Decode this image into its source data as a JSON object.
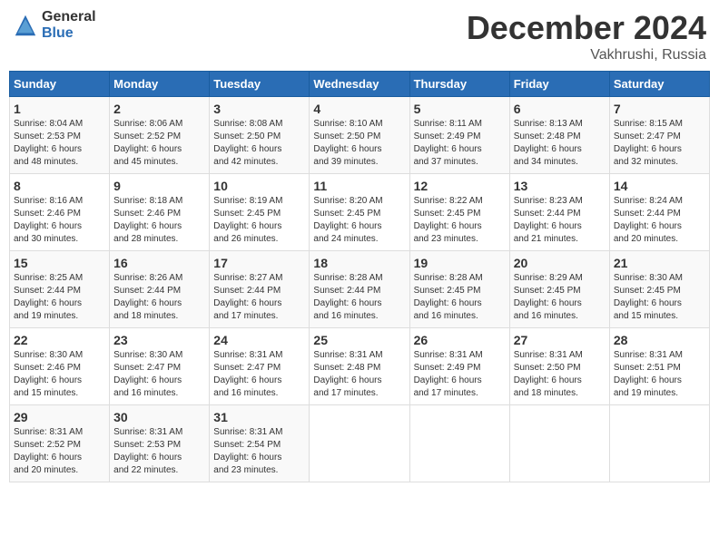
{
  "header": {
    "logo_general": "General",
    "logo_blue": "Blue",
    "title": "December 2024",
    "subtitle": "Vakhrushi, Russia"
  },
  "columns": [
    "Sunday",
    "Monday",
    "Tuesday",
    "Wednesday",
    "Thursday",
    "Friday",
    "Saturday"
  ],
  "weeks": [
    [
      {
        "day": "1",
        "info": "Sunrise: 8:04 AM\nSunset: 2:53 PM\nDaylight: 6 hours\nand 48 minutes."
      },
      {
        "day": "2",
        "info": "Sunrise: 8:06 AM\nSunset: 2:52 PM\nDaylight: 6 hours\nand 45 minutes."
      },
      {
        "day": "3",
        "info": "Sunrise: 8:08 AM\nSunset: 2:50 PM\nDaylight: 6 hours\nand 42 minutes."
      },
      {
        "day": "4",
        "info": "Sunrise: 8:10 AM\nSunset: 2:50 PM\nDaylight: 6 hours\nand 39 minutes."
      },
      {
        "day": "5",
        "info": "Sunrise: 8:11 AM\nSunset: 2:49 PM\nDaylight: 6 hours\nand 37 minutes."
      },
      {
        "day": "6",
        "info": "Sunrise: 8:13 AM\nSunset: 2:48 PM\nDaylight: 6 hours\nand 34 minutes."
      },
      {
        "day": "7",
        "info": "Sunrise: 8:15 AM\nSunset: 2:47 PM\nDaylight: 6 hours\nand 32 minutes."
      }
    ],
    [
      {
        "day": "8",
        "info": "Sunrise: 8:16 AM\nSunset: 2:46 PM\nDaylight: 6 hours\nand 30 minutes."
      },
      {
        "day": "9",
        "info": "Sunrise: 8:18 AM\nSunset: 2:46 PM\nDaylight: 6 hours\nand 28 minutes."
      },
      {
        "day": "10",
        "info": "Sunrise: 8:19 AM\nSunset: 2:45 PM\nDaylight: 6 hours\nand 26 minutes."
      },
      {
        "day": "11",
        "info": "Sunrise: 8:20 AM\nSunset: 2:45 PM\nDaylight: 6 hours\nand 24 minutes."
      },
      {
        "day": "12",
        "info": "Sunrise: 8:22 AM\nSunset: 2:45 PM\nDaylight: 6 hours\nand 23 minutes."
      },
      {
        "day": "13",
        "info": "Sunrise: 8:23 AM\nSunset: 2:44 PM\nDaylight: 6 hours\nand 21 minutes."
      },
      {
        "day": "14",
        "info": "Sunrise: 8:24 AM\nSunset: 2:44 PM\nDaylight: 6 hours\nand 20 minutes."
      }
    ],
    [
      {
        "day": "15",
        "info": "Sunrise: 8:25 AM\nSunset: 2:44 PM\nDaylight: 6 hours\nand 19 minutes."
      },
      {
        "day": "16",
        "info": "Sunrise: 8:26 AM\nSunset: 2:44 PM\nDaylight: 6 hours\nand 18 minutes."
      },
      {
        "day": "17",
        "info": "Sunrise: 8:27 AM\nSunset: 2:44 PM\nDaylight: 6 hours\nand 17 minutes."
      },
      {
        "day": "18",
        "info": "Sunrise: 8:28 AM\nSunset: 2:44 PM\nDaylight: 6 hours\nand 16 minutes."
      },
      {
        "day": "19",
        "info": "Sunrise: 8:28 AM\nSunset: 2:45 PM\nDaylight: 6 hours\nand 16 minutes."
      },
      {
        "day": "20",
        "info": "Sunrise: 8:29 AM\nSunset: 2:45 PM\nDaylight: 6 hours\nand 16 minutes."
      },
      {
        "day": "21",
        "info": "Sunrise: 8:30 AM\nSunset: 2:45 PM\nDaylight: 6 hours\nand 15 minutes."
      }
    ],
    [
      {
        "day": "22",
        "info": "Sunrise: 8:30 AM\nSunset: 2:46 PM\nDaylight: 6 hours\nand 15 minutes."
      },
      {
        "day": "23",
        "info": "Sunrise: 8:30 AM\nSunset: 2:47 PM\nDaylight: 6 hours\nand 16 minutes."
      },
      {
        "day": "24",
        "info": "Sunrise: 8:31 AM\nSunset: 2:47 PM\nDaylight: 6 hours\nand 16 minutes."
      },
      {
        "day": "25",
        "info": "Sunrise: 8:31 AM\nSunset: 2:48 PM\nDaylight: 6 hours\nand 17 minutes."
      },
      {
        "day": "26",
        "info": "Sunrise: 8:31 AM\nSunset: 2:49 PM\nDaylight: 6 hours\nand 17 minutes."
      },
      {
        "day": "27",
        "info": "Sunrise: 8:31 AM\nSunset: 2:50 PM\nDaylight: 6 hours\nand 18 minutes."
      },
      {
        "day": "28",
        "info": "Sunrise: 8:31 AM\nSunset: 2:51 PM\nDaylight: 6 hours\nand 19 minutes."
      }
    ],
    [
      {
        "day": "29",
        "info": "Sunrise: 8:31 AM\nSunset: 2:52 PM\nDaylight: 6 hours\nand 20 minutes."
      },
      {
        "day": "30",
        "info": "Sunrise: 8:31 AM\nSunset: 2:53 PM\nDaylight: 6 hours\nand 22 minutes."
      },
      {
        "day": "31",
        "info": "Sunrise: 8:31 AM\nSunset: 2:54 PM\nDaylight: 6 hours\nand 23 minutes."
      },
      null,
      null,
      null,
      null
    ]
  ]
}
